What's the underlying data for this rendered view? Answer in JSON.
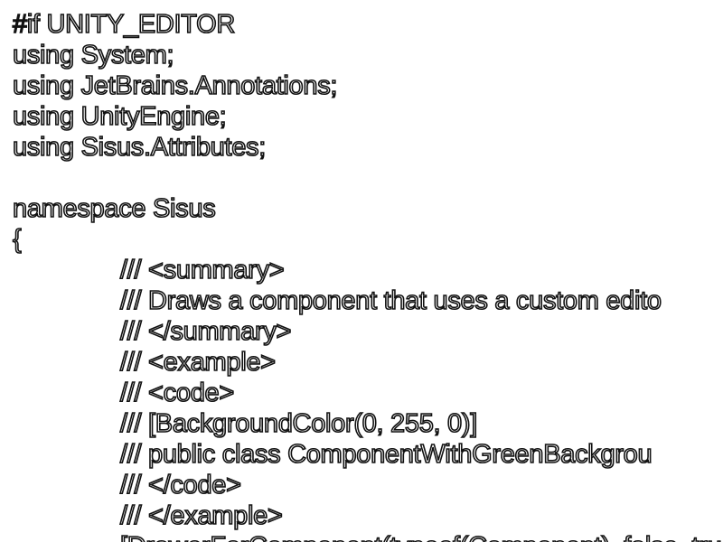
{
  "code": {
    "lines": [
      "#if UNITY_EDITOR",
      "using System;",
      "using JetBrains.Annotations;",
      "using UnityEngine;",
      "using Sisus.Attributes;",
      "",
      "namespace Sisus",
      "{",
      "/// <summary>",
      "/// Draws a component that uses a custom edito",
      "/// </summary>",
      "/// <example>",
      "/// <code>",
      "/// [BackgroundColor(0, 255, 0)]",
      "/// public class ComponentWithGreenBackgrou",
      "/// </code>",
      "/// </example>",
      "[DrawerForComponent(typeof(Component), false, true)]"
    ]
  }
}
